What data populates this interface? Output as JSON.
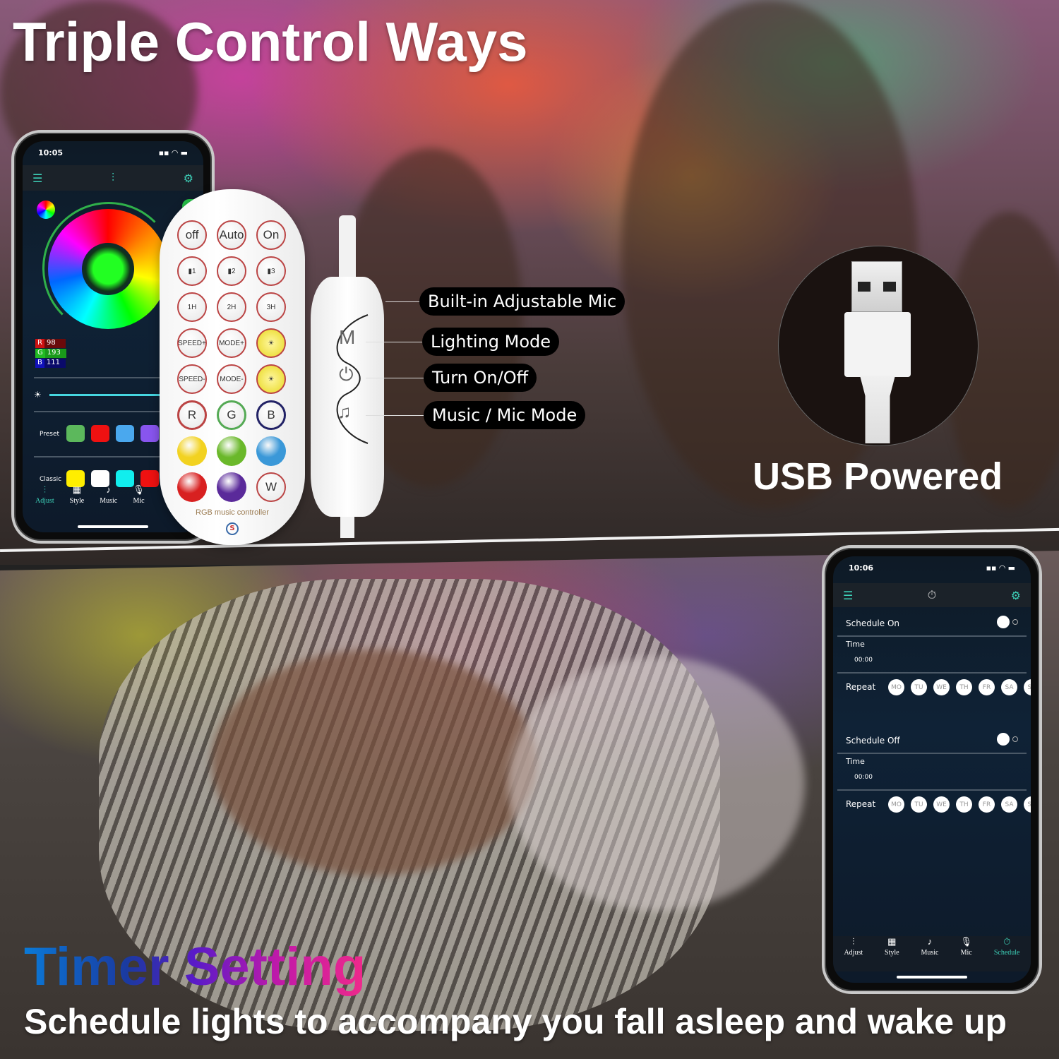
{
  "headline": "Triple Control Ways",
  "phone_app": {
    "time": "10:05",
    "status_icons": "signal wifi battery",
    "appbar": {
      "menu_icon": "☰",
      "center_icon": "⫶",
      "settings_icon": "⚙"
    },
    "rgb": {
      "r_label": "R",
      "r": "98",
      "g_label": "G",
      "g": "193",
      "b_label": "B",
      "b": "111"
    },
    "brightness_icon": "☀",
    "preset_label": "Preset",
    "preset_colors": [
      "#5cb85c",
      "#ee1111",
      "#4aa8ee",
      "#8855ee",
      "#eeee00"
    ],
    "classic_label": "Classic",
    "classic_colors": [
      "#ffee00",
      "#ffffff",
      "#11eeee",
      "#ee1111",
      "#22ee22"
    ],
    "tabs": [
      {
        "icon": "⫶",
        "label": "Adjust"
      },
      {
        "icon": "▦",
        "label": "Style"
      },
      {
        "icon": "♪",
        "label": "Music"
      },
      {
        "icon": "🎙",
        "label": "Mic"
      }
    ]
  },
  "remote": {
    "buttons": [
      [
        "off",
        "Auto",
        "On"
      ],
      [
        "▮1",
        "▮2",
        "▮3"
      ],
      [
        "1H",
        "2H",
        "3H"
      ],
      [
        "SPEED+",
        "MODE+",
        "☀"
      ],
      [
        "SPEED-",
        "MODE-",
        "☀"
      ],
      [
        "R",
        "G",
        "B"
      ],
      [
        "",
        "",
        ""
      ],
      [
        "",
        "",
        "W"
      ]
    ],
    "color_buttons": [
      "#f2d220",
      "#6ab82a",
      "#3a98d8",
      "#d82020",
      "#5a2a9a"
    ],
    "label": "RGB music controller",
    "logo": "S"
  },
  "controller": {
    "features": [
      "Built-in Adjustable Mic",
      "Lighting Mode",
      "Turn On/Off",
      "Music / Mic Mode"
    ],
    "icons": {
      "mode": "M",
      "power": "⏻",
      "music": "♫"
    }
  },
  "usb": {
    "label": "USB Powered"
  },
  "schedule_app": {
    "time": "10:06",
    "appbar": {
      "menu_icon": "☰",
      "center_icon": "⏱",
      "settings_icon": "⚙"
    },
    "schedule_on": {
      "label": "Schedule On",
      "time_label": "Time",
      "time": "00:00",
      "repeat_label": "Repeat"
    },
    "schedule_off": {
      "label": "Schedule Off",
      "time_label": "Time",
      "time": "00:00",
      "repeat_label": "Repeat"
    },
    "days": [
      "MO",
      "TU",
      "WE",
      "TH",
      "FR",
      "SA",
      "SU"
    ],
    "tabs": [
      {
        "icon": "⫶",
        "label": "Adjust"
      },
      {
        "icon": "▦",
        "label": "Style"
      },
      {
        "icon": "♪",
        "label": "Music"
      },
      {
        "icon": "🎙",
        "label": "Mic"
      },
      {
        "icon": "⏱",
        "label": "Schedule"
      }
    ],
    "accent": "#3dd0b8"
  },
  "timer": {
    "title": "Timer Setting",
    "subtitle": "Schedule lights to accompany you fall asleep and wake up"
  }
}
